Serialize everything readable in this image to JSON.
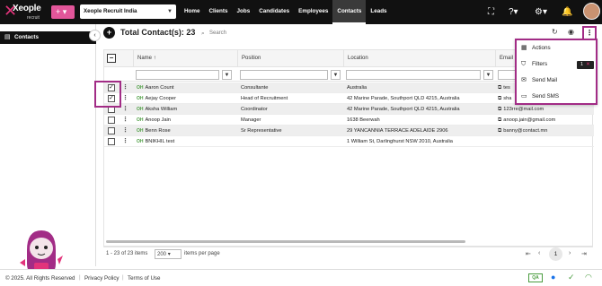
{
  "topbar": {
    "logo_text": "Xeople",
    "logo_sub": "recruit",
    "plus_label": "+ ▾",
    "org": "Xeople Recruit India",
    "nav": [
      "Home",
      "Clients",
      "Jobs",
      "Candidates",
      "Employees",
      "Contacts",
      "Leads"
    ],
    "active_nav": "Contacts",
    "icons": [
      "fullscreen-icon",
      "help-icon",
      "settings-icon",
      "bell-icon"
    ]
  },
  "sidebar": {
    "items": [
      {
        "label": "Contacts"
      }
    ],
    "collapse": "‹"
  },
  "header": {
    "add": "+",
    "title": "Total Contact(s): 23",
    "search_placeholder": "Search",
    "kebab": "⋮"
  },
  "grid": {
    "columns": [
      "Name",
      "Position",
      "Location",
      "Email"
    ],
    "sort_indicator": "↑",
    "rows": [
      {
        "tag": "OH",
        "name": "Aaron Count",
        "position": "Consultante",
        "location": "Australia",
        "email": "tes",
        "checked": true,
        "highlight": true
      },
      {
        "tag": "OH",
        "name": "Aejay Cooper",
        "position": "Head of Recruitment",
        "location": "42 Marine Parade, Southport QLD 4215, Australia",
        "email": "sha",
        "checked": true,
        "highlight": false
      },
      {
        "tag": "OH",
        "name": "Aksha William",
        "position": "Coordinator",
        "location": "42 Marine Parade, Southport QLD 4215, Australia",
        "email": "123rre@mail.com",
        "checked": false,
        "highlight": true
      },
      {
        "tag": "OH",
        "name": "Anoop Jain",
        "position": "Manager",
        "location": "1638 Beerwah",
        "email": "anoop.jain@gmail.com",
        "checked": false,
        "highlight": false
      },
      {
        "tag": "OH",
        "name": "Benn Rose",
        "position": "Sr Representative",
        "location": "29 YANCANNIA TERRACE ADELAIDE 2906",
        "email": "banny@contact.mn",
        "checked": false,
        "highlight": true
      },
      {
        "tag": "OH",
        "name": "BNIKHIL test",
        "position": "",
        "location": "1 William St, Darlinghurst NSW 2010, Australia",
        "email": "",
        "checked": false,
        "highlight": false
      }
    ]
  },
  "pager": {
    "info": "1 - 23 of 23 items",
    "page_size": "200",
    "page_size_label": "items per page",
    "current_page": "1"
  },
  "menu": {
    "items": [
      {
        "label": "Actions",
        "icon": "table-icon"
      },
      {
        "label": "Filters",
        "icon": "filter-icon",
        "badge": "1"
      },
      {
        "label": "Send Mail",
        "icon": "mail-icon"
      },
      {
        "label": "Send SMS",
        "icon": "chat-icon"
      }
    ]
  },
  "footer": {
    "copyright": "© 2025. All Rights Reserved",
    "privacy": "Privacy Policy",
    "terms": "Terms of Use",
    "qa": "QA"
  }
}
